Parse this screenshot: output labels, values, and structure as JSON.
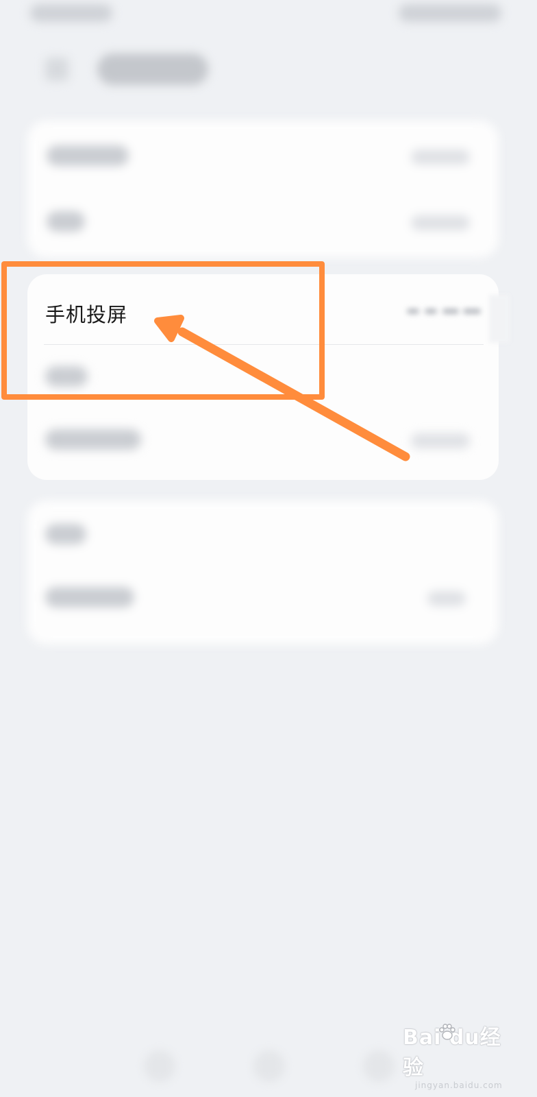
{
  "settings_row": {
    "title": "手机投屏"
  },
  "watermark": {
    "brand": "Bai du经验",
    "url": "jingyan.baidu.com"
  },
  "colors": {
    "annotation": "#ff8c3c",
    "background": "#eff1f4",
    "card": "#fdfdfd"
  },
  "icons": {
    "back": "chevron-left-icon",
    "arrow": "annotation-arrow-icon",
    "paw": "baidu-paw-icon"
  }
}
